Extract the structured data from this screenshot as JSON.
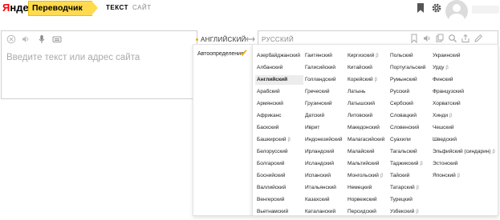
{
  "header": {
    "logo_part1": "Я",
    "logo_part2": "ндекс",
    "service": "Переводчик",
    "tabs": [
      {
        "label": "ТЕКСТ",
        "active": true
      },
      {
        "label": "САЙТ",
        "active": false
      }
    ],
    "icons": [
      "bookmark-icon",
      "gear-icon",
      "user-avatar"
    ]
  },
  "source": {
    "placeholder": "Введите текст или адрес сайта",
    "toolbar_icons": [
      "clear-icon",
      "speaker-icon",
      "microphone-icon",
      "keyboard-icon"
    ]
  },
  "language_bar": {
    "source_lang": "АНГЛИЙСКИЙ",
    "target_lang": "РУССКИЙ",
    "target_toolbar_icons": [
      "bookmark-icon",
      "speaker-icon",
      "copy-icon",
      "search-icon",
      "share-icon",
      "edit-icon"
    ]
  },
  "dropdown": {
    "autodetect": "Автоопределение",
    "selected": "Английский",
    "beta_marker": "β",
    "columns": [
      [
        "Азербайджанский",
        "Албанский",
        "Английский",
        "Арабский",
        "Армянский",
        "Африканс",
        "Баскский",
        "Башкирский β",
        "Белорусский",
        "Болгарский",
        "Боснийский",
        "Валлийский",
        "Венгерский",
        "Вьетнамский"
      ],
      [
        "Гаитянский",
        "Галисийский",
        "Голландский",
        "Греческий",
        "Грузинский",
        "Датский",
        "Иврит",
        "Индонезийский",
        "Ирландский",
        "Исландский",
        "Испанский",
        "Итальянский",
        "Казахский",
        "Каталанский"
      ],
      [
        "Киргизский β",
        "Китайский",
        "Корейский β",
        "Латынь",
        "Латышский",
        "Литовский",
        "Македонский",
        "Малагасийский",
        "Малайский",
        "Мальтийский",
        "Монгольский β",
        "Немецкий",
        "Норвежский",
        "Персидский"
      ],
      [
        "Польский",
        "Португальский",
        "Румынский",
        "Русский",
        "Сербский",
        "Словацкий",
        "Словенский",
        "Суахили",
        "Тагальский",
        "Таджикский β",
        "Тайский",
        "Татарский β",
        "Турецкий",
        "Узбекский β"
      ],
      [
        "Украинский",
        "Урду β",
        "Финский",
        "Французский",
        "Хорватский",
        "Хинди β",
        "Чешский",
        "Шведский",
        "Эльфийский (синдарин) β",
        "Эстонский",
        "Японский β"
      ]
    ]
  },
  "colors": {
    "accent_yellow": "#ffdb4d",
    "logo_red": "#ff0000",
    "check": "#f0a800"
  }
}
